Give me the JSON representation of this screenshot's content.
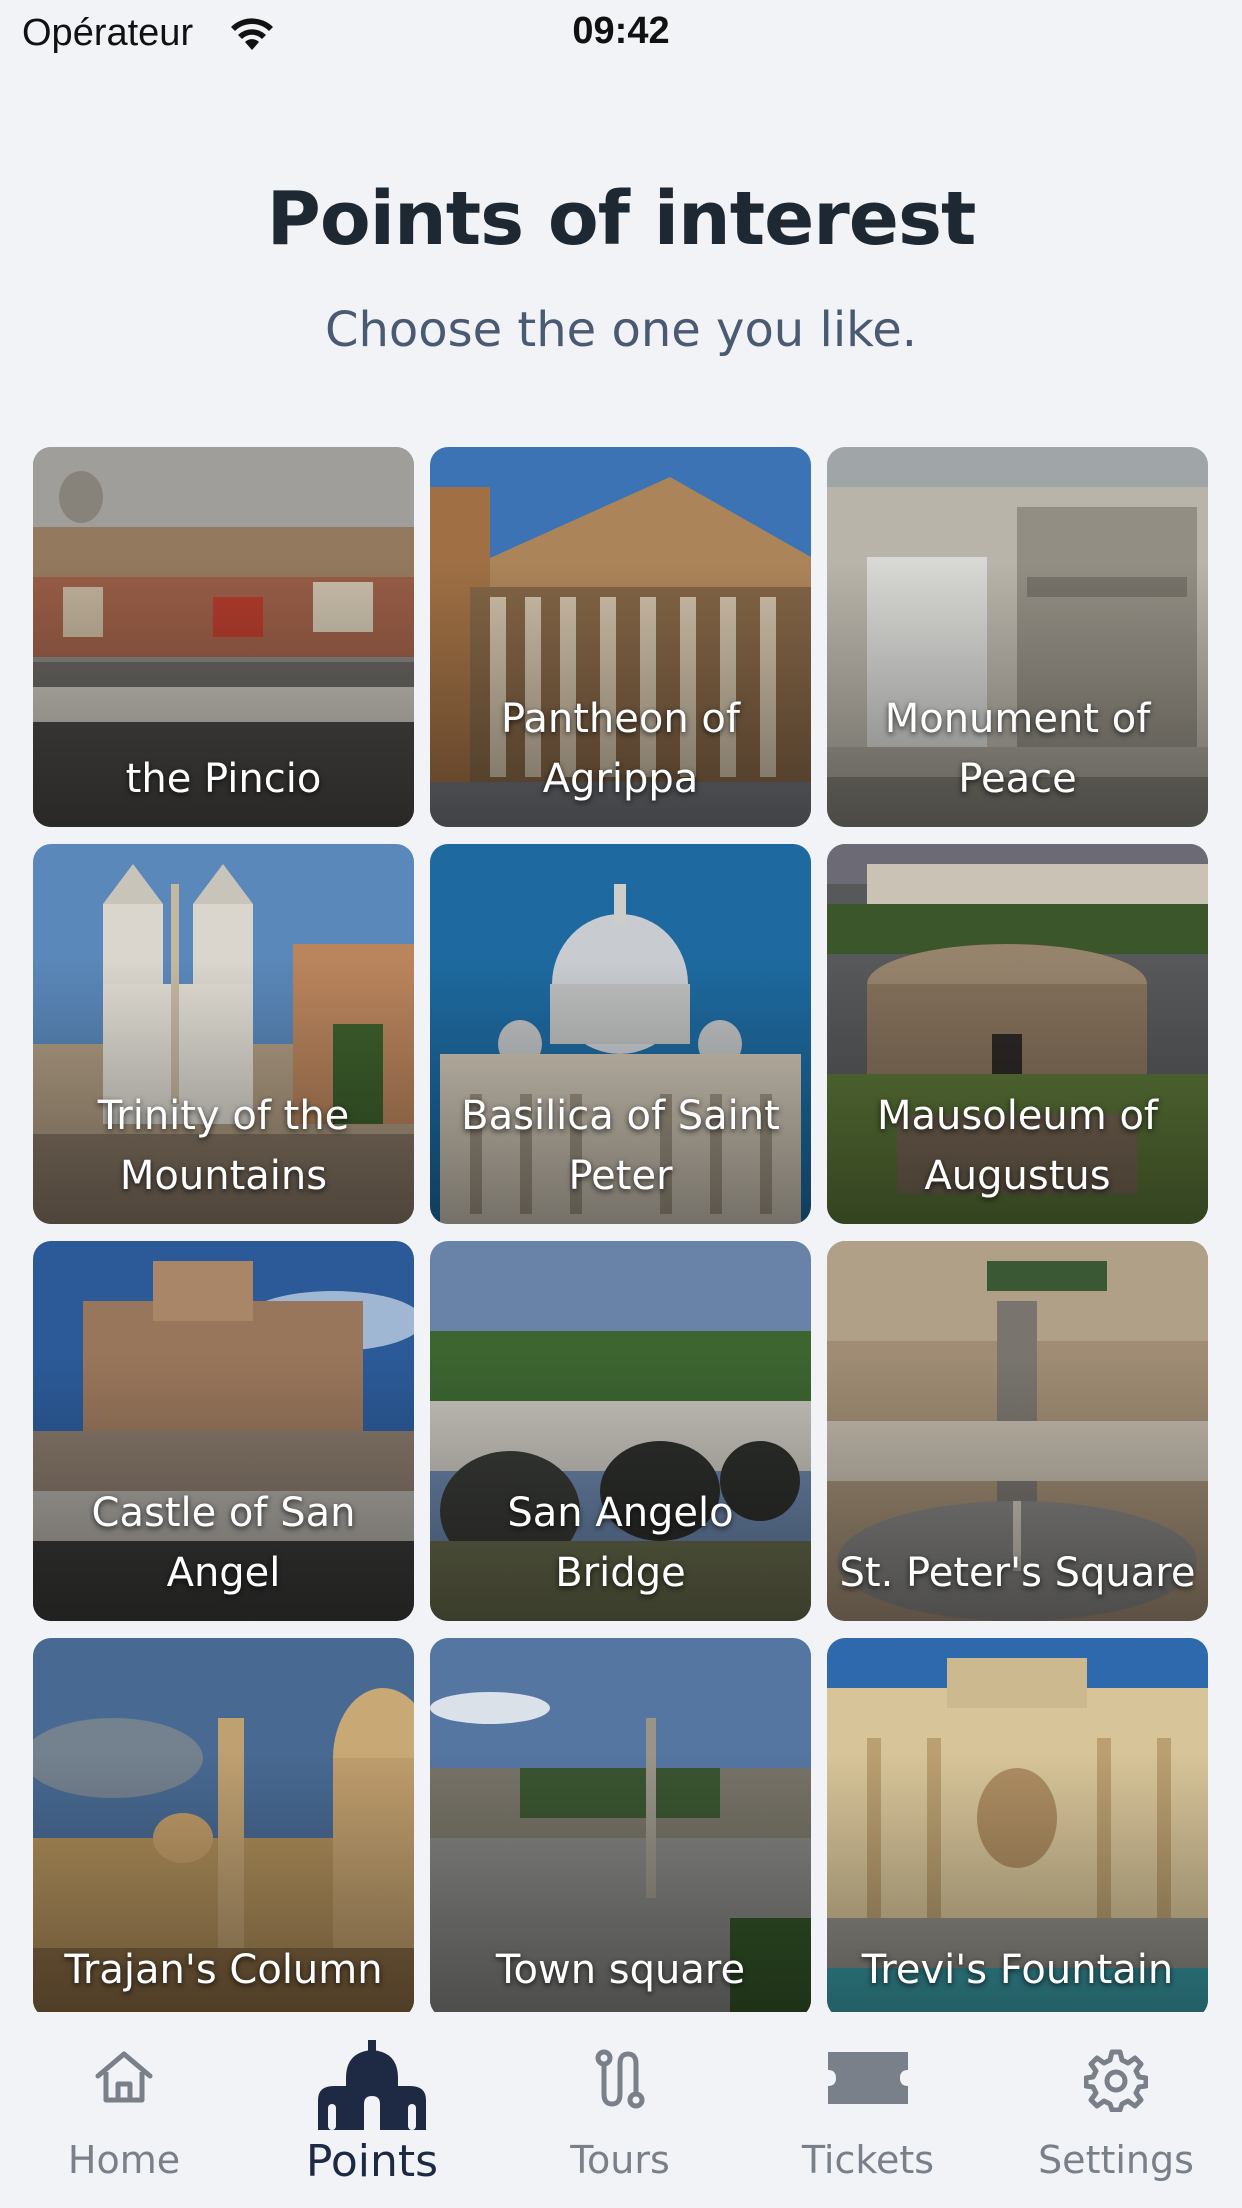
{
  "status_bar": {
    "carrier": "Opérateur",
    "time": "09:42"
  },
  "header": {
    "title": "Points of interest",
    "subtitle": "Choose the one you like."
  },
  "points": [
    {
      "label": "the Pincio"
    },
    {
      "label": "Pantheon of Agrippa"
    },
    {
      "label": "Monument of Peace"
    },
    {
      "label": "Trinity of the Mountains"
    },
    {
      "label": "Basilica of Saint Peter"
    },
    {
      "label": "Mausoleum of Augustus"
    },
    {
      "label": "Castle of San Angel"
    },
    {
      "label": "San Angelo Bridge"
    },
    {
      "label": "St. Peter's Square"
    },
    {
      "label": "Trajan's Column"
    },
    {
      "label": "Town square"
    },
    {
      "label": "Trevi's Fountain"
    }
  ],
  "tab_bar": {
    "tabs": [
      {
        "label": "Home",
        "icon": "home-icon"
      },
      {
        "label": "Points",
        "icon": "church-icon"
      },
      {
        "label": "Tours",
        "icon": "route-icon"
      },
      {
        "label": "Tickets",
        "icon": "ticket-icon"
      },
      {
        "label": "Settings",
        "icon": "gear-icon"
      }
    ],
    "active_tab": "Points"
  },
  "colors": {
    "background": "#f1f3f7",
    "active_tab": "#1e2a44",
    "inactive_tab": "#7a8089"
  }
}
